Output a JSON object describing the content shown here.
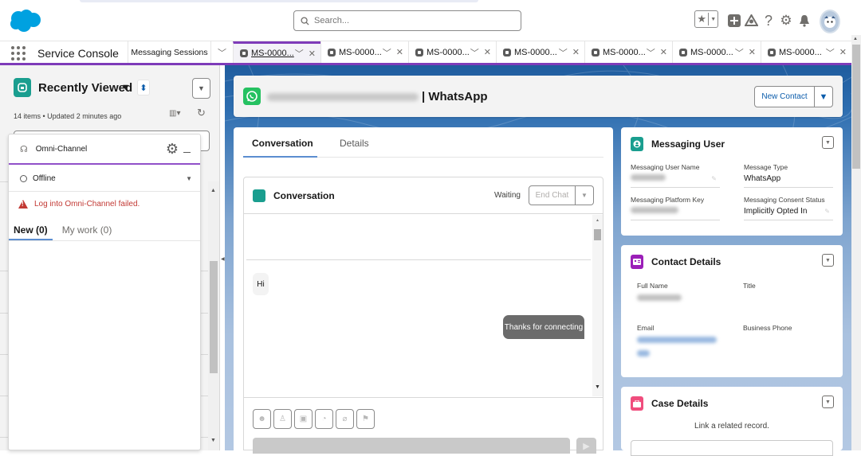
{
  "header": {
    "search_placeholder": "Search...",
    "icons": [
      "favorites-star-icon",
      "favorites-dropdown-icon",
      "global-actions-plus-icon",
      "trailhead-icon",
      "help-icon",
      "setup-gear-icon",
      "notifications-bell-icon",
      "user-avatar"
    ]
  },
  "nav": {
    "app_name": "Service Console",
    "object_tab": "Messaging Sessions",
    "tabs": [
      {
        "label": "MS-0000...",
        "active": true
      },
      {
        "label": "MS-0000...",
        "active": false
      },
      {
        "label": "MS-0000...",
        "active": false
      },
      {
        "label": "MS-0000...",
        "active": false
      },
      {
        "label": "MS-0000...",
        "active": false
      },
      {
        "label": "MS-0000...",
        "active": false
      },
      {
        "label": "MS-0000...",
        "active": false
      }
    ],
    "chevron": "⌄",
    "close": "✕"
  },
  "list_view": {
    "title": "Recently Viewed",
    "caret": "▼",
    "pin": "📌",
    "subtitle": "14 items • Updated 2 minutes ago",
    "refresh": "↻",
    "columns": "▥▾"
  },
  "omni": {
    "title": "Omni-Channel",
    "status": "Offline",
    "error": "Log into Omni-Channel failed.",
    "tabs": [
      {
        "label": "New (0)",
        "active": true
      },
      {
        "label": "My work (0)",
        "active": false
      }
    ]
  },
  "highlight": {
    "title_suffix": "| WhatsApp",
    "title_name_redacted": true,
    "new_contact": "New Contact"
  },
  "conversation_tabs": [
    {
      "label": "Conversation",
      "active": true
    },
    {
      "label": "Details",
      "active": false
    }
  ],
  "conversation": {
    "title": "Conversation",
    "status": "Waiting",
    "end_chat": "End Chat",
    "messages": [
      {
        "direction": "inbound",
        "text": "Hi"
      },
      {
        "direction": "outbound",
        "text": "Thanks for connecting"
      }
    ],
    "toolbar": [
      "emoji-icon",
      "transfer-agent-icon",
      "quick-text-icon",
      "knowledge-icon",
      "attachment-icon",
      "flag-icon"
    ]
  },
  "messaging_user": {
    "title": "Messaging User",
    "fields": [
      {
        "label": "Messaging User Name",
        "value": "",
        "redacted": true
      },
      {
        "label": "Message Type",
        "value": "WhatsApp"
      },
      {
        "label": "Messaging Platform Key",
        "value": "",
        "redacted": true
      },
      {
        "label": "Messaging Consent Status",
        "value": "Implicitly Opted In"
      }
    ]
  },
  "contact_details": {
    "title": "Contact Details",
    "fields": [
      {
        "label": "Full Name",
        "value": "",
        "redacted": true
      },
      {
        "label": "Title",
        "value": ""
      },
      {
        "label": "Email",
        "value": "",
        "redacted": true
      },
      {
        "label": "Business Phone",
        "value": ""
      }
    ]
  },
  "case_details": {
    "title": "Case Details",
    "link_text": "Link a related record."
  },
  "colors": {
    "brand_purple": "#7e3bb9",
    "whatsapp_green": "#25c161",
    "teal_icon": "#1a9e8f",
    "contact_purple": "#9b1fb8",
    "case_pink": "#f04d7d",
    "link_blue": "#0b5cab",
    "error_red": "#c23934"
  }
}
